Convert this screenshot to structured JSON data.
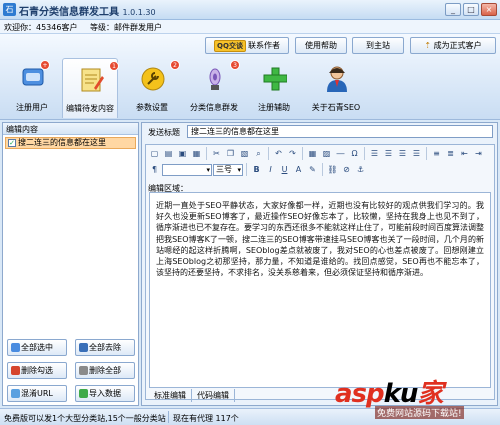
{
  "window": {
    "title": "石青分类信息群发工具",
    "version": "1.0.1.30",
    "minimize": "_",
    "maximize": "□",
    "close": "×"
  },
  "welcome": {
    "greeting": "欢迎你：45346客户",
    "level": "等级：邮件群发用户"
  },
  "topbar": {
    "qq_badge": "QQ交谈",
    "contact_author": "联系作者",
    "help": "使用帮助",
    "home": "到主站",
    "upgrade": "成为正式客户"
  },
  "tools": [
    {
      "label": "注册用户",
      "badge": ""
    },
    {
      "label": "编辑待发内容",
      "badge": "1"
    },
    {
      "label": "参数设置",
      "badge": "2"
    },
    {
      "label": "分类信息群发",
      "badge": "3"
    },
    {
      "label": "注册辅助",
      "badge": ""
    },
    {
      "label": "关于石青SEO",
      "badge": ""
    }
  ],
  "left_panel": {
    "header": "编辑内容",
    "items": [
      "搜二连三的信息都在这里"
    ],
    "buttons": {
      "select_all": "全部选中",
      "clear_all": "全部去除",
      "delete_selected": "删除勾选",
      "delete_all": "删除全部",
      "mix_url": "混淆URL",
      "import": "导入数据"
    }
  },
  "editor": {
    "subject_label": "发送标题",
    "subject_value": "搜二连三的信息都在这里",
    "font_size": "三号",
    "area_label": "编辑区域：",
    "content": "近期一直处于SEO平静状态，大家好像都一样，近期也没有比较好的观点供我们学习的。我好久也没更新SEO博客了，最近操作SEO好像忘本了，比较懒，坚持在我身上也见不到了，循序渐进也已不复存在。要学习的东西还很多不能就这样止住了，可能前段时间百度算法调整把我SEO博客K了一顿，搜二连三的SEO博客带速挂马SEO博客也关了一段时间，几个月的新站嗯经的起这样折腾啊，SEOblog差点就被废了，我对SEO的心也差点被废了。回想刚建立上海SEOblog之初那坚持，那力量，不知道是谁给的。找回点感觉，SEO再也不能忘本了，该坚持的还要坚持，不求排名，没关系慈着来，但必须保证坚持和循序渐进。",
    "tabs": [
      "标准编辑",
      "代码编辑"
    ]
  },
  "status": {
    "left": "免费版可以发1个大型分类站,15个一般分类站",
    "right": "现在有代理 117个"
  },
  "watermark": {
    "brand_a": "asp",
    "brand_b": "ku",
    "brand_c": "家",
    "sub": "免费网站源码下载站!"
  }
}
